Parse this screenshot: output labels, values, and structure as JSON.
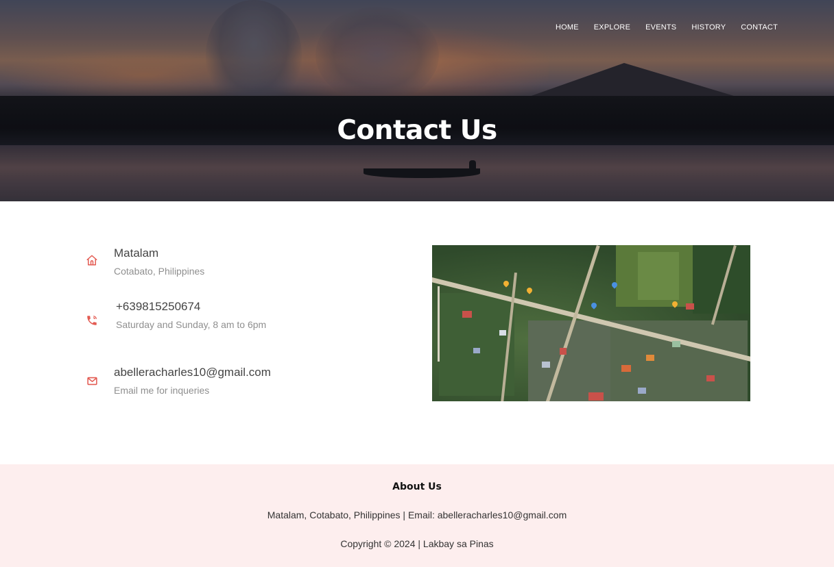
{
  "nav": {
    "items": [
      {
        "label": "HOME"
      },
      {
        "label": "EXPLORE"
      },
      {
        "label": "EVENTS"
      },
      {
        "label": "HISTORY"
      },
      {
        "label": "CONTACT"
      }
    ]
  },
  "hero": {
    "title": "Contact Us"
  },
  "contact": {
    "items": [
      {
        "icon": "home-icon",
        "title": "Matalam",
        "subtitle": "Cotabato, Philippines"
      },
      {
        "icon": "phone-icon",
        "title": "+639815250674",
        "subtitle": "Saturday and Sunday, 8 am to 6pm"
      },
      {
        "icon": "envelope-icon",
        "title": "abelleracharles10@gmail.com",
        "subtitle": "Email me for inqueries"
      }
    ]
  },
  "map": {
    "type": "satellite"
  },
  "footer": {
    "title": "About Us",
    "line": "Matalam, Cotabato, Philippines | Email: abelleracharles10@gmail.com",
    "copyright": "Copyright © 2024 | Lakbay sa Pinas"
  },
  "colors": {
    "accent": "#e35b52",
    "footer_bg": "#fdeeee"
  }
}
